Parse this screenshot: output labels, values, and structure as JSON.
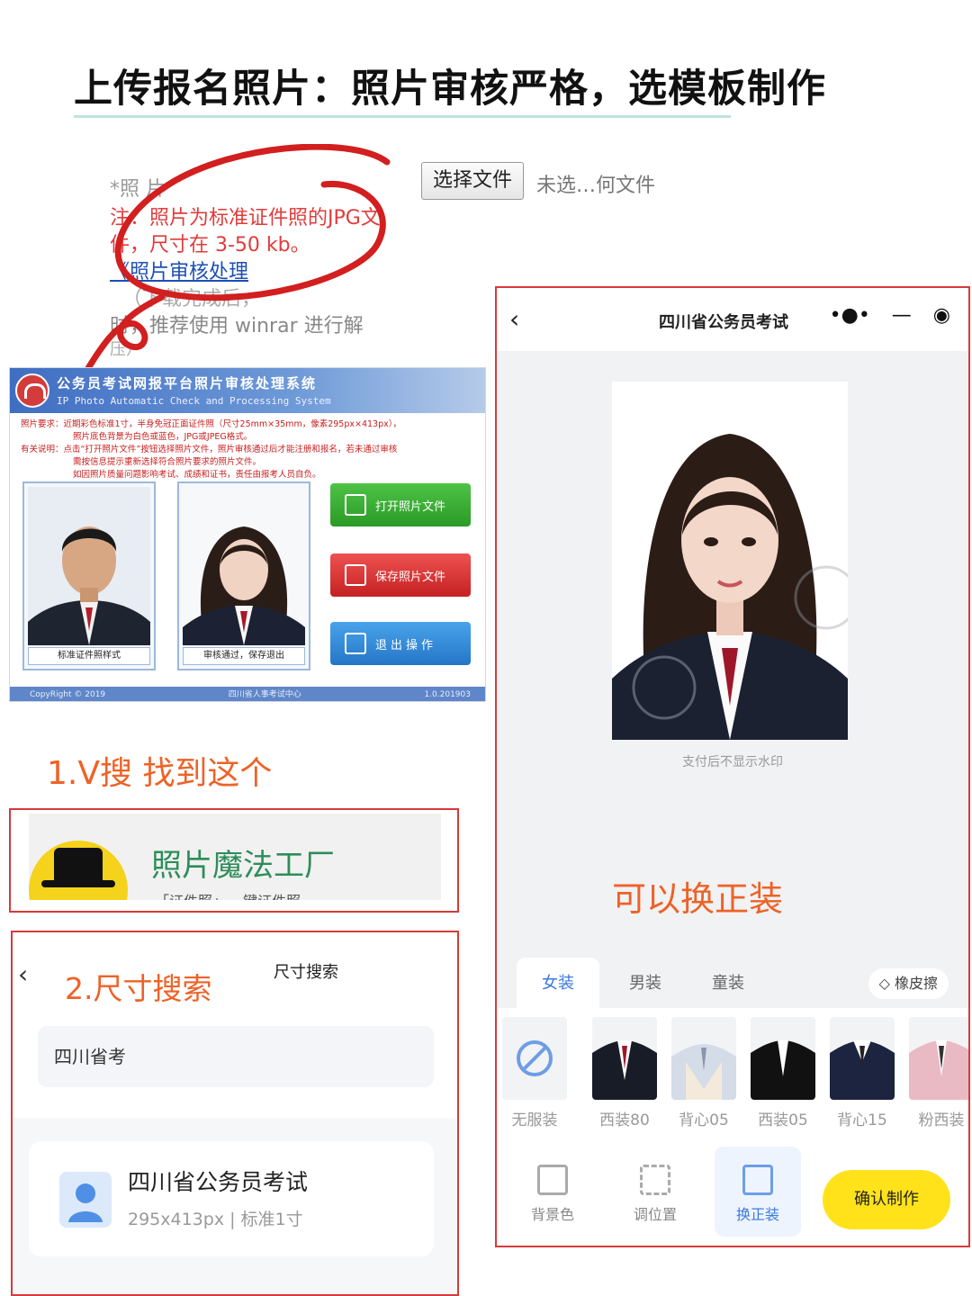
{
  "headline": "上传报名照片：照片审核严格，选模板制作",
  "upload": {
    "label": "*照    片",
    "note_line1": "注：照片为标准证件照的JPG文",
    "note_line2": "件，尺寸在 3-50 kb。",
    "link": "《照片审核处理",
    "hint1": "（下载完成后，",
    "hint2": "时，推荐使用 winrar 进行解",
    "hint3": "压）",
    "choose_button": "选择文件",
    "no_file": "未选…何文件"
  },
  "software": {
    "title": "公务员考试网报平台照片审核处理系统",
    "subtitle": "IP Photo Automatic Check and Processing System",
    "req_label": "照片要求：",
    "req_line1": "近期彩色标准1寸，半身免冠正面证件照（尺寸25mm×35mm，像素295px×413px），",
    "req_line2": "照片底色背景为白色或蓝色，JPG或JPEG格式。",
    "note_label": "有关说明：",
    "note_line1": "点击“打开照片文件”按钮选择照片文件，照片审核通过后才能注册和报名，若未通过审核",
    "note_line2": "需按信息提示重新选择符合照片要求的照片文件。",
    "note_line3": "如因照片质量问题影响考试、成绩和证书，责任由报考人员自负。",
    "sample1_caption": "标准证件照样式",
    "sample2_caption": "审核通过，保存退出",
    "btn_open": "打开照片文件",
    "btn_save": "保存照片文件",
    "btn_exit": "退出操作",
    "footer_left": "CopyRight © 2019",
    "footer_mid": "四川省人事考试中心",
    "footer_right": "1.0.201903"
  },
  "step1": {
    "label": "1.V搜  找到这个",
    "app_name": "照片魔法工厂",
    "app_sub": "「证件照」·  一键证件照"
  },
  "step2": {
    "label": "2.尺寸搜索",
    "nav_title": "尺寸搜索",
    "search_value": "四川省考",
    "result_title": "四川省公务员考试",
    "result_sub": "295x413px | 标准1寸"
  },
  "phone": {
    "title": "四川省公务员考试",
    "watermark_note": "支付后不显示水印",
    "overlay": "可以换正装",
    "tabs": [
      "女装",
      "男装",
      "童装"
    ],
    "eraser": "橡皮擦",
    "clothes": [
      "无服装",
      "西装80",
      "背心05",
      "西装05",
      "背心15",
      "粉西装"
    ],
    "bottom": [
      "背景色",
      "调位置",
      "换正装"
    ],
    "confirm": "确认制作"
  },
  "colors": {
    "accent_orange": "#ee6227",
    "highlight_red": "#d73a3a",
    "confirm_yellow": "#ffe21a",
    "tab_blue": "#3a7ae0"
  }
}
